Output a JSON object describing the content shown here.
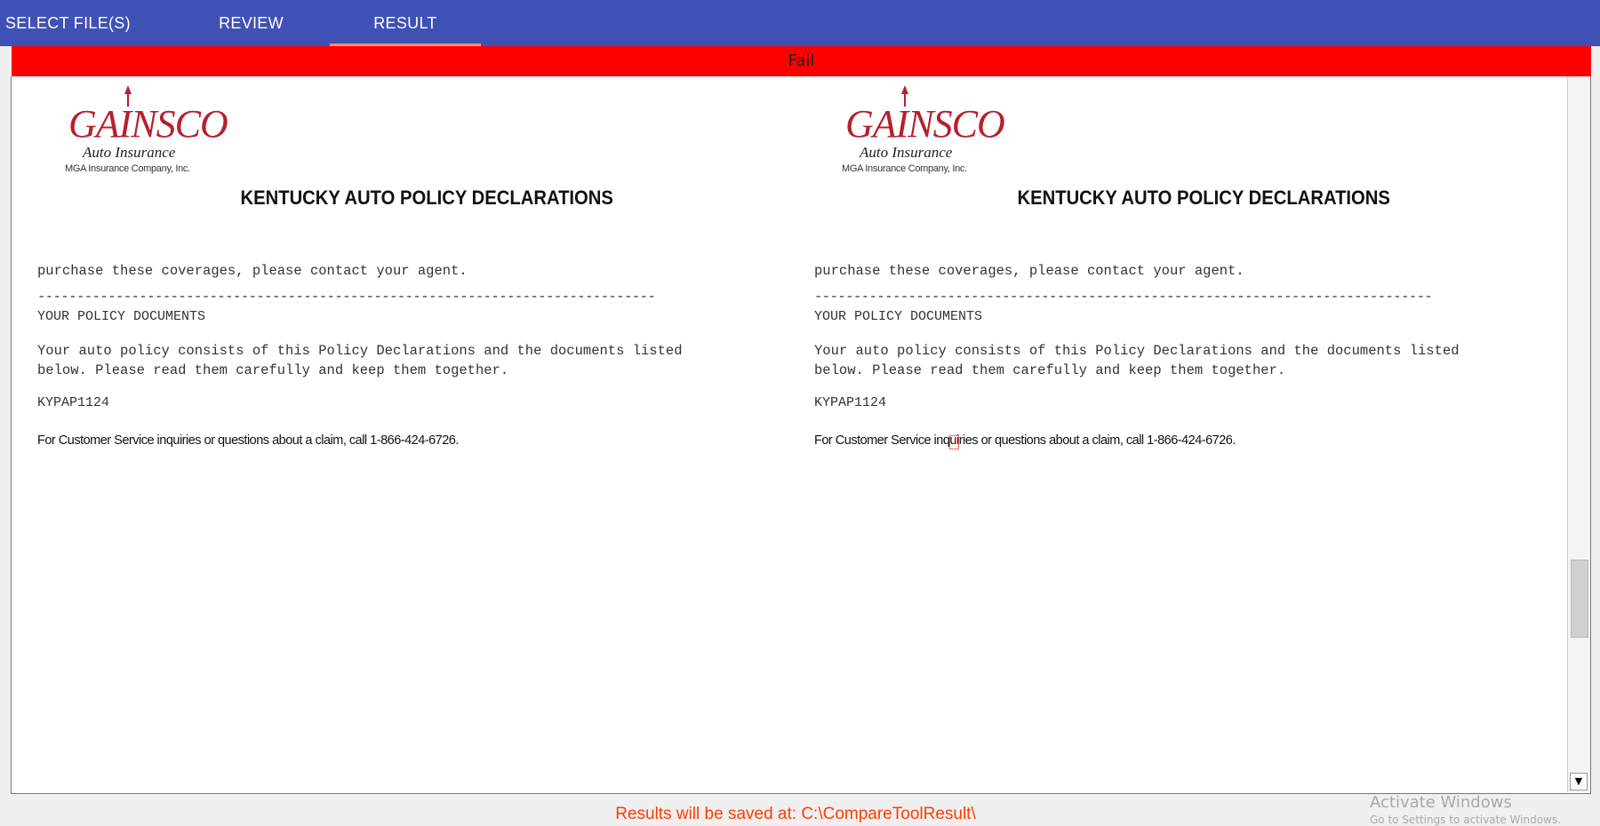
{
  "tabs": [
    {
      "label": "SELECT FILE(S)"
    },
    {
      "label": "REVIEW"
    },
    {
      "label": "RESULT"
    }
  ],
  "status": {
    "text": "Fail",
    "color": "#ff0000"
  },
  "panes": [
    {
      "logo": {
        "brand": "GAINSCO",
        "subtitle": "Auto Insurance",
        "company": "MGA Insurance Company, Inc."
      },
      "title": "KENTUCKY AUTO POLICY DECLARATIONS",
      "purchase_line": "purchase these coverages, please contact your agent.",
      "rule": "-------------------------------------------------------------------------------",
      "section_heading": "YOUR POLICY DOCUMENTS",
      "body_line1": "Your auto policy consists of this Policy Declarations and the documents listed",
      "body_line2": "below. Please read them carefully and keep them together.",
      "form_code": "KYPAP1124",
      "service_line": "For Customer Service inquiries or questions about a claim, call 1-866-424-6726."
    },
    {
      "logo": {
        "brand": "GAINSCO",
        "subtitle": "Auto Insurance",
        "company": "MGA Insurance Company, Inc."
      },
      "title": "KENTUCKY AUTO POLICY DECLARATIONS",
      "purchase_line": "purchase these coverages, please contact your agent.",
      "rule": "-------------------------------------------------------------------------------",
      "section_heading": "YOUR POLICY DOCUMENTS",
      "body_line1": "Your auto policy consists of this Policy Declarations and the documents listed",
      "body_line2": "below. Please read them carefully and keep them together.",
      "form_code": "KYPAP1124",
      "service_line": "For Customer Service inquiries or questions about a claim, call 1-866-424-6726."
    }
  ],
  "footer": {
    "text": "Results will be saved at: C:\\CompareToolResult\\"
  },
  "watermark": {
    "line1": "Activate Windows",
    "line2": "Go to Settings to activate Windows."
  },
  "colors": {
    "tabbar": "#3f51b5",
    "tab_indicator": "#ff8a80",
    "fail": "#ff0000",
    "footer_text": "#ff3d00",
    "logo_red": "#b5202e"
  }
}
